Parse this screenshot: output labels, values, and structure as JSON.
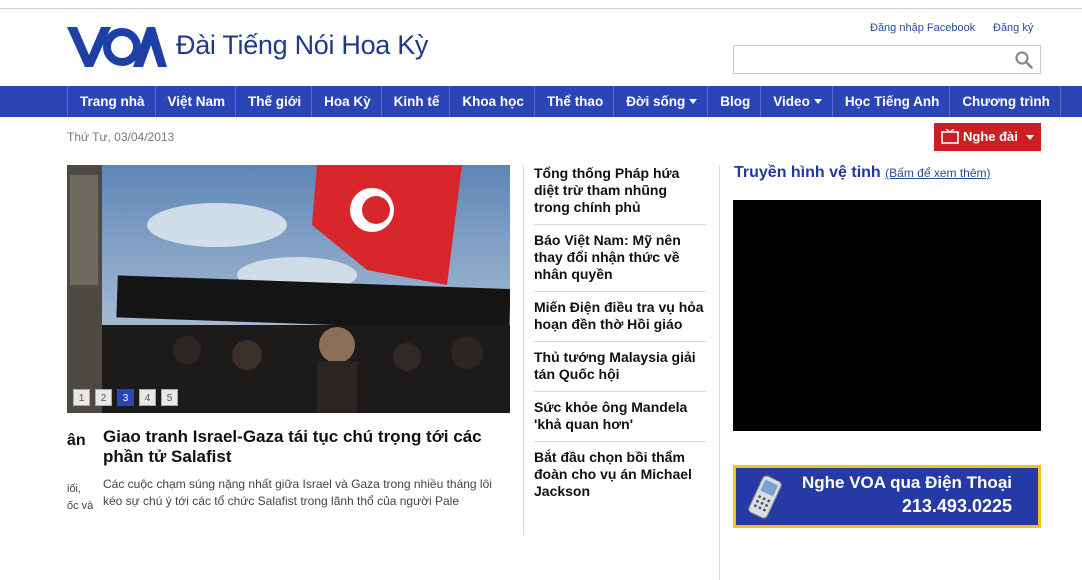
{
  "header": {
    "site_title": "Đài Tiếng Nói Hoa Kỳ",
    "logo_text": "VOA",
    "login_facebook": "Đăng nhập Facebook",
    "register": "Đăng ký",
    "search_placeholder": ""
  },
  "nav": {
    "items": [
      {
        "label": "Trang nhà"
      },
      {
        "label": "Việt Nam"
      },
      {
        "label": "Thế giới"
      },
      {
        "label": "Hoa Kỳ"
      },
      {
        "label": "Kinh tế"
      },
      {
        "label": "Khoa học"
      },
      {
        "label": "Thể thao"
      },
      {
        "label": "Đời sống"
      },
      {
        "label": "Blog"
      },
      {
        "label": "Video"
      },
      {
        "label": "Học Tiếng Anh"
      },
      {
        "label": "Chương trình"
      }
    ]
  },
  "date": "Thứ Tư, 03/04/2013",
  "radio_button": "Nghe đài",
  "carousel": {
    "pages": [
      "1",
      "2",
      "3",
      "4",
      "5"
    ],
    "active_page": "3",
    "prev_fragment_title": "ân",
    "prev_fragment_lines": [
      "iối,",
      "ốc và"
    ],
    "title": "Giao tranh Israel-Gaza tái tục chú trọng tới các phần tử Salafist",
    "description": "Các cuộc chạm súng nặng nhất giữa Israel và Gaza trong nhiều tháng lôi kéo sự chú ý tới các tổ chức Salafist trong lãnh thổ của người Pale"
  },
  "headlines": [
    "Tổng thống Pháp hứa diệt trừ tham nhũng trong chính phủ",
    "Báo Việt Nam: Mỹ nên thay đổi nhận thức về nhân quyền",
    "Miến Điện điều tra vụ hỏa hoạn đền thờ Hồi giáo",
    "Thủ tướng Malaysia giải tán Quốc hội",
    "Sức khỏe ông Mandela 'khả quan hơn'",
    "Bắt đầu chọn bồi thẩm đoàn cho vụ án Michael Jackson"
  ],
  "sidebar": {
    "tv_title": "Truyền hình vệ tinh",
    "tv_more": "(Bấm để xem thêm)",
    "phone_title": "Nghe VOA qua Điện Thoại",
    "phone_number": "213.493.0225"
  },
  "colors": {
    "nav_bg": "#2b44b6",
    "brand_blue": "#1e3a8a",
    "radio_red": "#cc1f25",
    "banner_yellow": "#f4c21a"
  }
}
